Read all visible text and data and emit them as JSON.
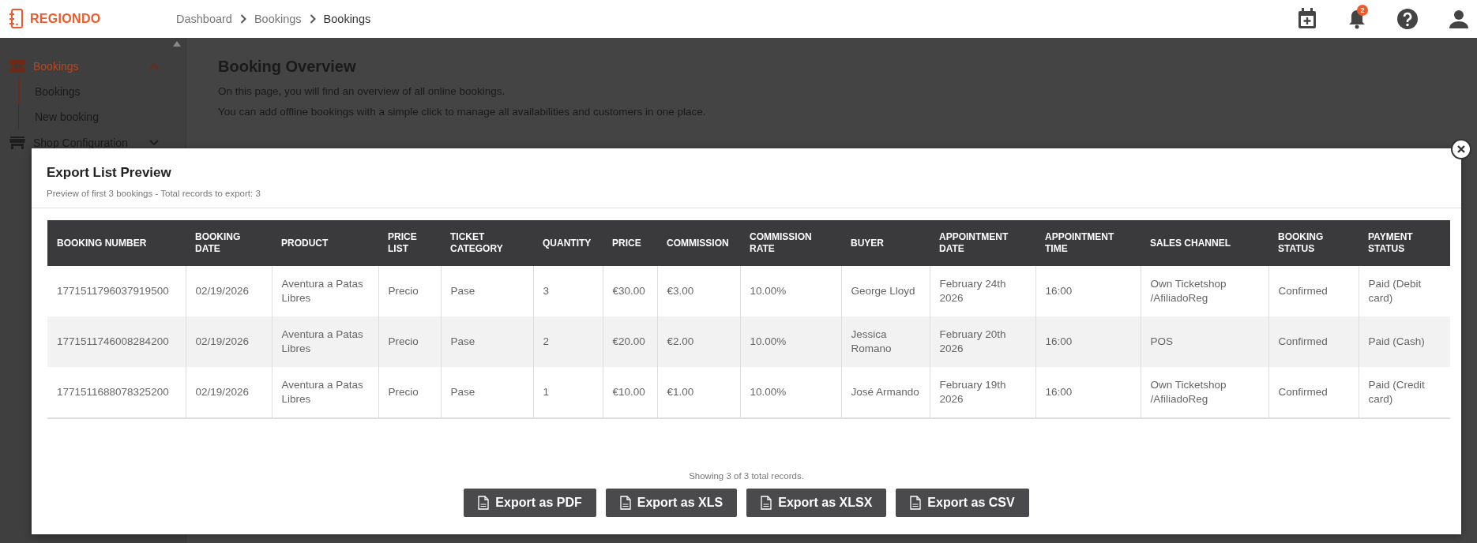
{
  "header": {
    "logo_text": "REGIONDO",
    "breadcrumbs": [
      {
        "label": "Dashboard",
        "current": false
      },
      {
        "label": "Bookings",
        "current": false
      },
      {
        "label": "Bookings",
        "current": true
      }
    ],
    "notification_count": "2"
  },
  "sidebar": {
    "items": [
      {
        "label": "Bookings",
        "selected": true,
        "expanded": true,
        "children": [
          {
            "label": "Bookings",
            "selected": true
          },
          {
            "label": "New booking",
            "selected": false
          }
        ]
      },
      {
        "label": "Shop Configuration",
        "selected": false,
        "expanded": false
      }
    ]
  },
  "page": {
    "title": "Booking Overview",
    "lines": [
      "On this page, you will find an overview of all online bookings.",
      "You can add offline bookings with a simple click to manage all availabilities and customers in one place."
    ]
  },
  "modal": {
    "title": "Export List Preview",
    "subtitle": "Preview of first 3 bookings - Total records to export: 3",
    "table": {
      "columns": [
        "BOOKING NUMBER",
        "BOOKING DATE",
        "PRODUCT",
        "PRICE LIST",
        "TICKET CATEGORY",
        "QUANTITY",
        "PRICE",
        "COMMISSION",
        "COMMISSION RATE",
        "BUYER",
        "APPOINTMENT DATE",
        "APPOINTMENT TIME",
        "SALES CHANNEL",
        "BOOKING STATUS",
        "PAYMENT STATUS"
      ],
      "rows": [
        [
          "1771511796037919500",
          "02/19/2026",
          "Aventura a Patas Libres",
          "Precio",
          "Pase",
          "3",
          "€30.00",
          "€3.00",
          "10.00%",
          "George Lloyd",
          "February 24th 2026",
          "16:00",
          "Own Ticketshop /AfiliadoReg",
          "Confirmed",
          "Paid (Debit card)"
        ],
        [
          "1771511746008284200",
          "02/19/2026",
          "Aventura a Patas Libres",
          "Precio",
          "Pase",
          "2",
          "€20.00",
          "€2.00",
          "10.00%",
          "Jessica Romano",
          "February 20th 2026",
          "16:00",
          "POS",
          "Confirmed",
          "Paid (Cash)"
        ],
        [
          "1771511688078325200",
          "02/19/2026",
          "Aventura a Patas Libres",
          "Precio",
          "Pase",
          "1",
          "€10.00",
          "€1.00",
          "10.00%",
          "José Armando",
          "February 19th 2026",
          "16:00",
          "Own Ticketshop /AfiliadoReg",
          "Confirmed",
          "Paid (Credit card)"
        ]
      ]
    },
    "summary": "Showing 3 of 3 total records.",
    "export_buttons": [
      "Export as PDF",
      "Export as XLS",
      "Export as XLSX",
      "Export as CSV"
    ]
  }
}
